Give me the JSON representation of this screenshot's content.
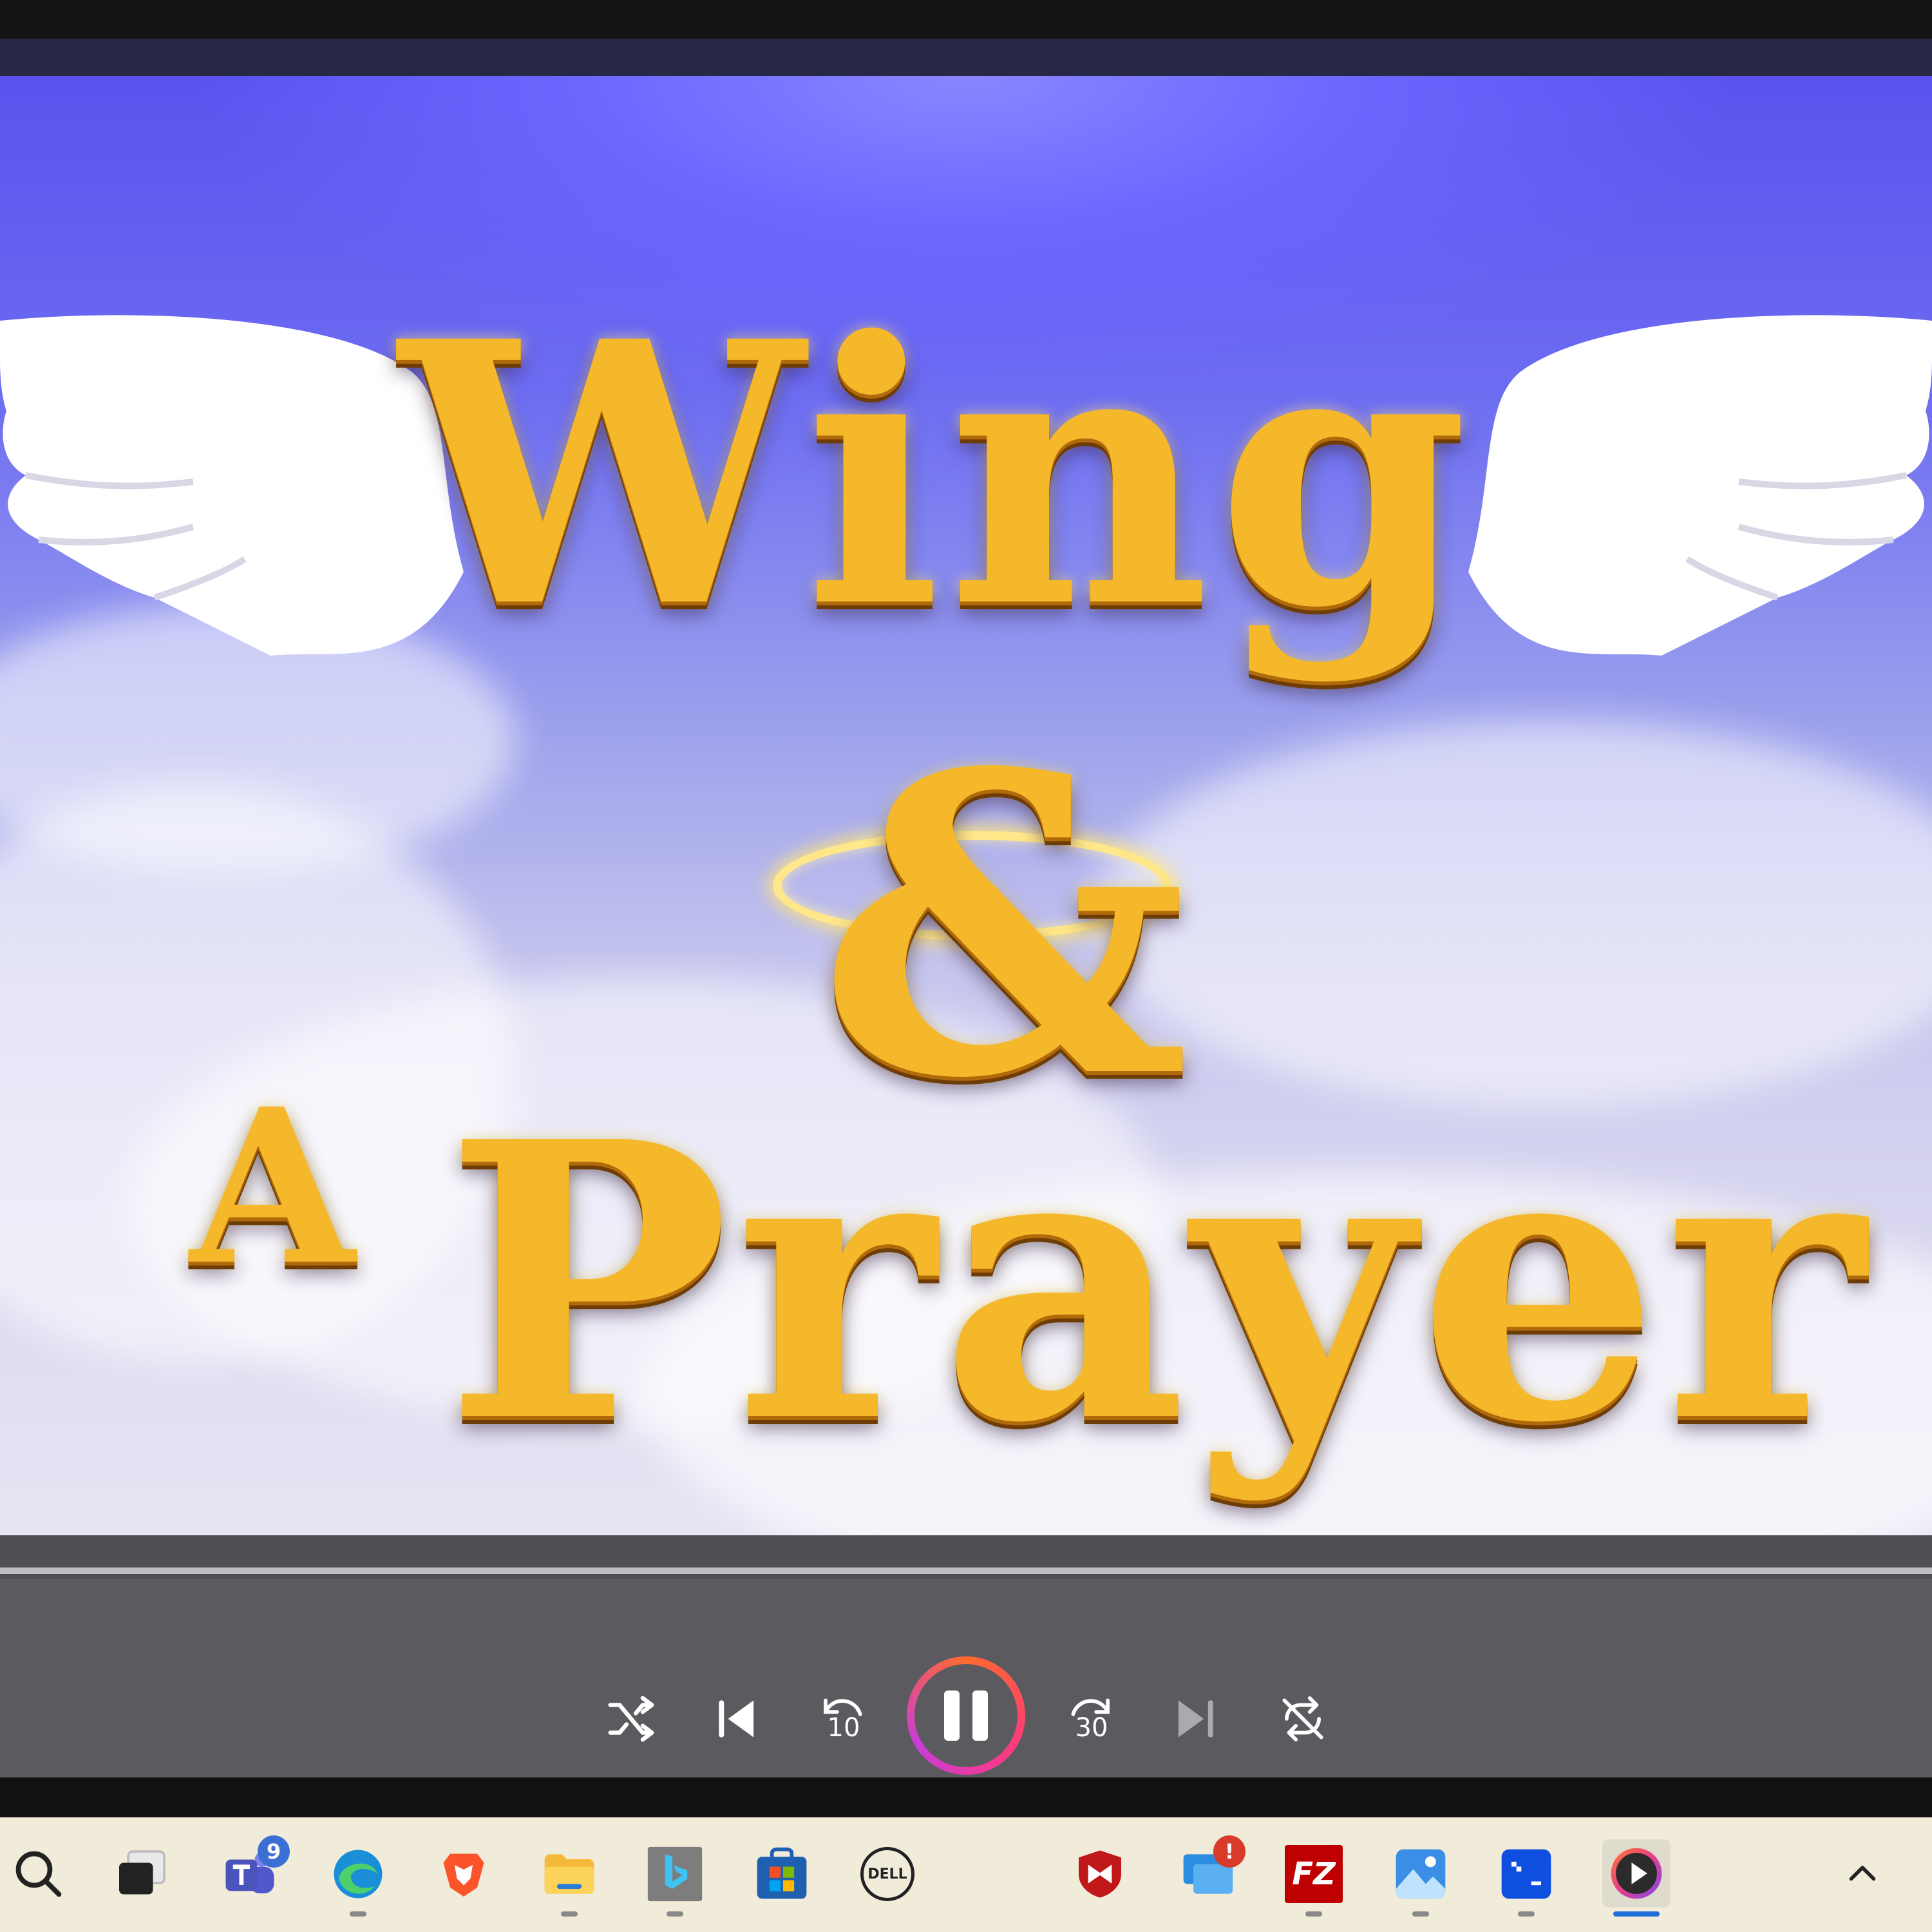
{
  "video": {
    "title_line1": "Wing",
    "title_amp": "&",
    "title_a": "A",
    "title_line2": "Prayer"
  },
  "player": {
    "skip_back_seconds": "10",
    "skip_forward_seconds": "30",
    "state": "playing"
  },
  "taskbar": {
    "teams_badge": "9",
    "alert_badge": "!",
    "dell_label": "DELL",
    "filezilla_label": "FZ"
  }
}
